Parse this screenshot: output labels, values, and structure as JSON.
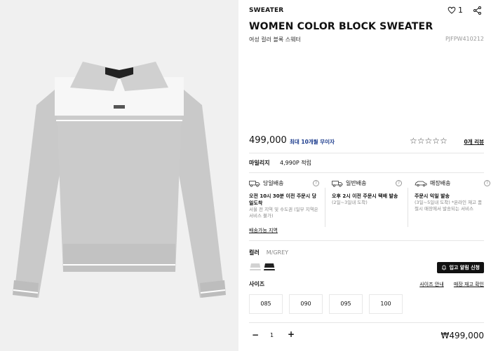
{
  "product": {
    "category": "SWEATER",
    "likes": "1",
    "title": "WOMEN COLOR BLOCK SWEATER",
    "subtitle": "여성 컬러 블록 스웨터",
    "code": "PJFPW410212",
    "price": "499,000",
    "installment": "최대 10개월 무이자",
    "stars": "☆☆☆☆☆",
    "review_link": "0개 리뷰"
  },
  "mileage": {
    "label": "마일리지",
    "value": "4,990P 적립"
  },
  "delivery": [
    {
      "icon": "truck-icon",
      "title": "당일배송",
      "main": "오전 10시 30분 이전 주문시 당일도착",
      "sub": "서울 전 지역 및 수도권 (일부 지역은 서비스 불가)"
    },
    {
      "icon": "truck-icon",
      "title": "일반배송",
      "main": "오후 2시 이전 주문시 택배 발송",
      "sub": "(2일~3일내 도착)"
    },
    {
      "icon": "car-icon",
      "title": "매장배송",
      "main": "주문시 익일 발송",
      "sub": "(3일~5일내 도착) *온라인 재고 품절시 매장에서 발송되는 서비스"
    }
  ],
  "delivery_link": "배송가능 지역",
  "color": {
    "label": "컬러",
    "value": "M/GREY"
  },
  "notify_button": "입고 알림 신청",
  "size": {
    "label": "사이즈",
    "guide": "사이즈 안내",
    "store_stock": "매장 재고 확인",
    "options": [
      "085",
      "090",
      "095",
      "100"
    ]
  },
  "quantity": {
    "minus": "−",
    "value": "1",
    "plus": "+"
  },
  "total": "₩499,000"
}
